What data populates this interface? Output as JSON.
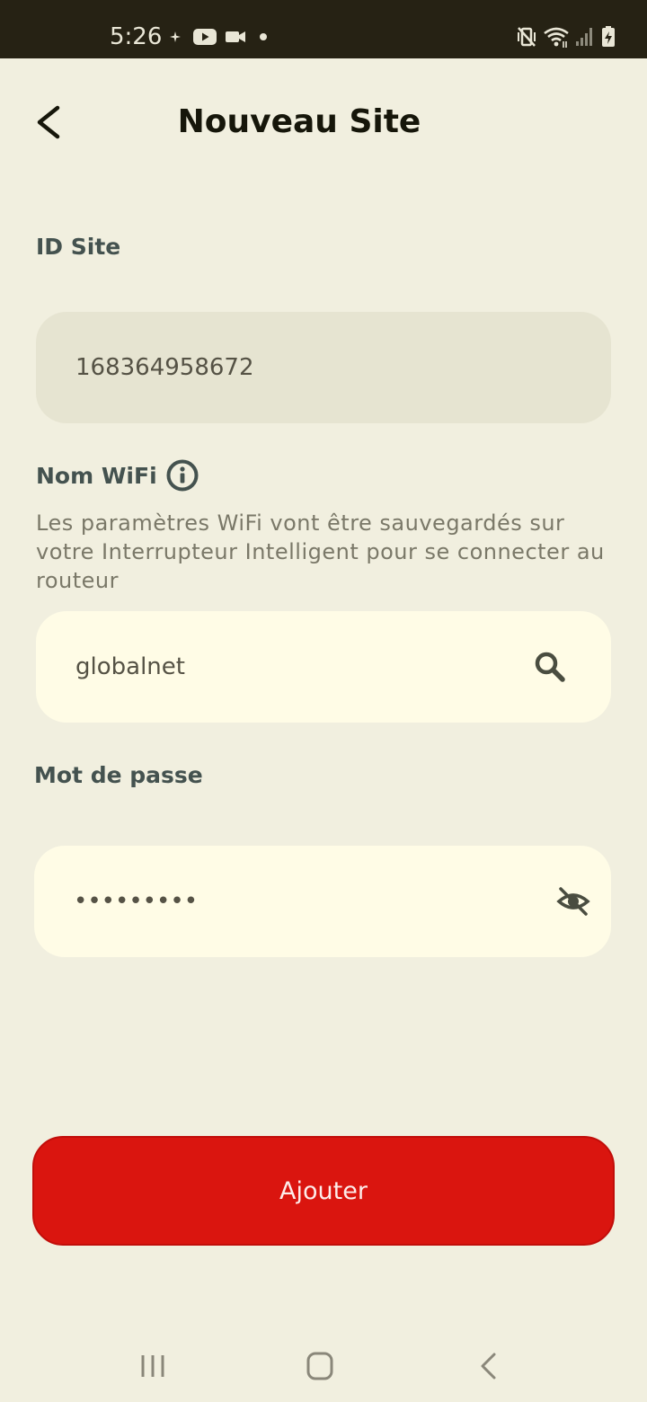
{
  "status_bar": {
    "time": "5:26",
    "icons": [
      "sparkle-icon",
      "youtube-icon",
      "video-camera-icon",
      "dot-icon",
      "vibrate-mute-icon",
      "wifi-icon",
      "signal-icon",
      "battery-charging-icon"
    ]
  },
  "header": {
    "title": "Nouveau Site",
    "back_icon": "chevron-left-icon"
  },
  "site_id": {
    "label": "ID Site",
    "value": "168364958672"
  },
  "wifi": {
    "label": "Nom WiFi",
    "info_icon": "info-icon",
    "helper": "Les paramètres WiFi vont être sauvegardés sur votre Interrupteur Intelligent pour se connecter au routeur",
    "value": "globalnet",
    "search_icon": "search-icon"
  },
  "password": {
    "label": "Mot de passe",
    "value": "•••••••••",
    "toggle_icon": "eye-off-icon"
  },
  "actions": {
    "add_label": "Ajouter"
  },
  "nav": {
    "icons": [
      "recent-apps-icon",
      "home-icon",
      "back-icon"
    ]
  },
  "colors": {
    "background": "#f1efdf",
    "status_bar": "#262214",
    "field_disabled": "#e6e4d1",
    "field_active": "#fffce6",
    "accent": "#da150f",
    "label": "#44524f"
  }
}
